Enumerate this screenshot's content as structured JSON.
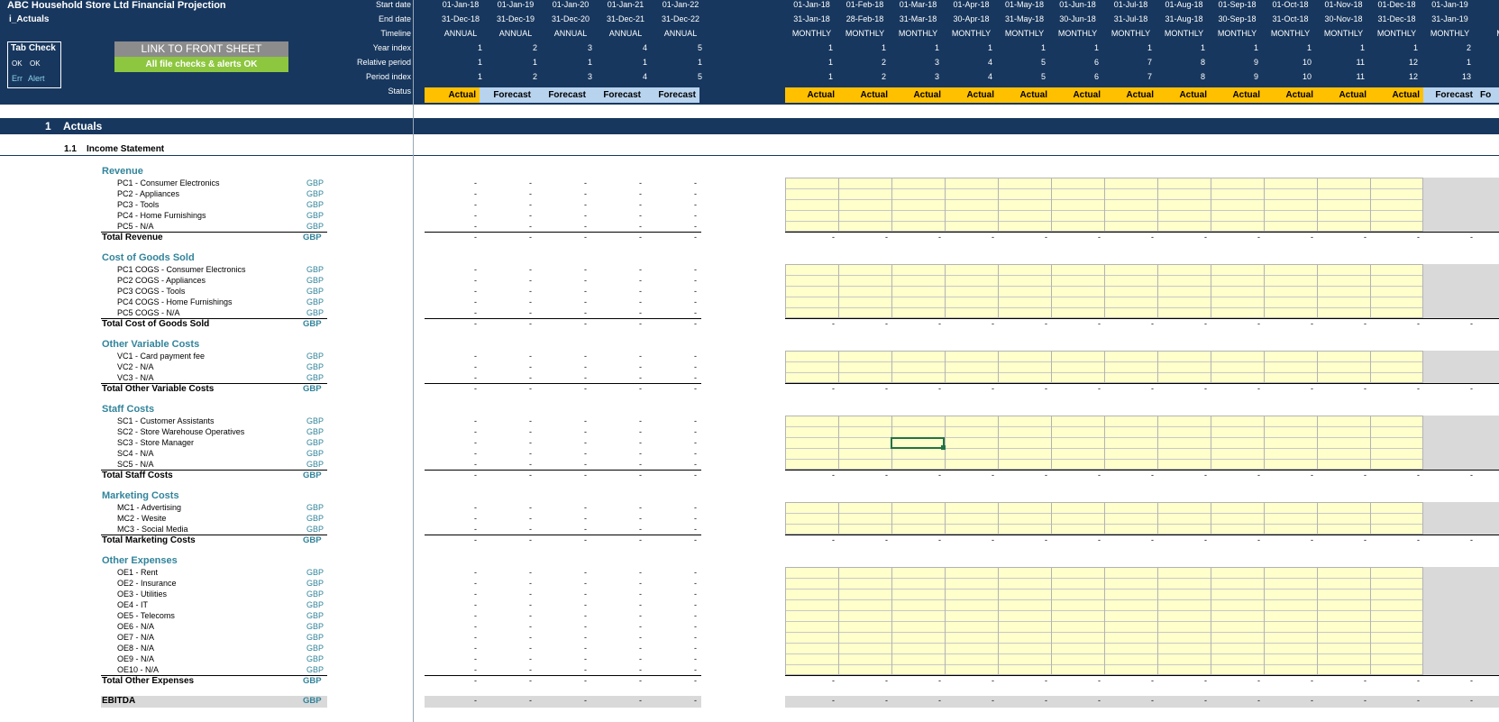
{
  "header": {
    "company_title": "ABC Household Store Ltd Financial Projection",
    "sheet_name": "i_Actuals",
    "row_labels": [
      "Start date",
      "End date",
      "Timeline",
      "Year index",
      "Relative period",
      "Period index",
      "Status"
    ],
    "annual_columns": [
      {
        "start": "01-Jan-18",
        "end": "31-Dec-18",
        "timeline": "ANNUAL",
        "year_index": "1",
        "relative_period": "1",
        "period_index": "1",
        "status": "Actual"
      },
      {
        "start": "01-Jan-19",
        "end": "31-Dec-19",
        "timeline": "ANNUAL",
        "year_index": "2",
        "relative_period": "1",
        "period_index": "2",
        "status": "Forecast"
      },
      {
        "start": "01-Jan-20",
        "end": "31-Dec-20",
        "timeline": "ANNUAL",
        "year_index": "3",
        "relative_period": "1",
        "period_index": "3",
        "status": "Forecast"
      },
      {
        "start": "01-Jan-21",
        "end": "31-Dec-21",
        "timeline": "ANNUAL",
        "year_index": "4",
        "relative_period": "1",
        "period_index": "4",
        "status": "Forecast"
      },
      {
        "start": "01-Jan-22",
        "end": "31-Dec-22",
        "timeline": "ANNUAL",
        "year_index": "5",
        "relative_period": "1",
        "period_index": "5",
        "status": "Forecast"
      }
    ],
    "monthly_columns": [
      {
        "start": "01-Jan-18",
        "end": "31-Jan-18",
        "timeline": "MONTHLY",
        "year_index": "1",
        "relative_period": "1",
        "period_index": "1",
        "status": "Actual"
      },
      {
        "start": "01-Feb-18",
        "end": "28-Feb-18",
        "timeline": "MONTHLY",
        "year_index": "1",
        "relative_period": "2",
        "period_index": "2",
        "status": "Actual"
      },
      {
        "start": "01-Mar-18",
        "end": "31-Mar-18",
        "timeline": "MONTHLY",
        "year_index": "1",
        "relative_period": "3",
        "period_index": "3",
        "status": "Actual"
      },
      {
        "start": "01-Apr-18",
        "end": "30-Apr-18",
        "timeline": "MONTHLY",
        "year_index": "1",
        "relative_period": "4",
        "period_index": "4",
        "status": "Actual"
      },
      {
        "start": "01-May-18",
        "end": "31-May-18",
        "timeline": "MONTHLY",
        "year_index": "1",
        "relative_period": "5",
        "period_index": "5",
        "status": "Actual"
      },
      {
        "start": "01-Jun-18",
        "end": "30-Jun-18",
        "timeline": "MONTHLY",
        "year_index": "1",
        "relative_period": "6",
        "period_index": "6",
        "status": "Actual"
      },
      {
        "start": "01-Jul-18",
        "end": "31-Jul-18",
        "timeline": "MONTHLY",
        "year_index": "1",
        "relative_period": "7",
        "period_index": "7",
        "status": "Actual"
      },
      {
        "start": "01-Aug-18",
        "end": "31-Aug-18",
        "timeline": "MONTHLY",
        "year_index": "1",
        "relative_period": "8",
        "period_index": "8",
        "status": "Actual"
      },
      {
        "start": "01-Sep-18",
        "end": "30-Sep-18",
        "timeline": "MONTHLY",
        "year_index": "1",
        "relative_period": "9",
        "period_index": "9",
        "status": "Actual"
      },
      {
        "start": "01-Oct-18",
        "end": "31-Oct-18",
        "timeline": "MONTHLY",
        "year_index": "1",
        "relative_period": "10",
        "period_index": "10",
        "status": "Actual"
      },
      {
        "start": "01-Nov-18",
        "end": "30-Nov-18",
        "timeline": "MONTHLY",
        "year_index": "1",
        "relative_period": "11",
        "period_index": "11",
        "status": "Actual"
      },
      {
        "start": "01-Dec-18",
        "end": "31-Dec-18",
        "timeline": "MONTHLY",
        "year_index": "1",
        "relative_period": "12",
        "period_index": "12",
        "status": "Actual"
      },
      {
        "start": "01-Jan-19",
        "end": "31-Jan-19",
        "timeline": "MONTHLY",
        "year_index": "2",
        "relative_period": "1",
        "period_index": "13",
        "status": "Forecast"
      },
      {
        "start": "",
        "end": "",
        "timeline": "MO",
        "year_index": "",
        "relative_period": "",
        "period_index": "",
        "status": "Fo"
      }
    ]
  },
  "tab_check": {
    "title": "Tab Check",
    "ok_1": "OK",
    "ok_2": "OK",
    "err": "Err",
    "alert": "Alert"
  },
  "buttons": {
    "link_front_sheet": "LINK TO FRONT SHEET",
    "checks_banner": "All file checks & alerts OK"
  },
  "section": {
    "number": "1",
    "title": "Actuals",
    "sub_number": "1.1",
    "sub_title": "Income Statement"
  },
  "unit": "GBP",
  "zero_value": "-",
  "groups": [
    {
      "title": "Revenue",
      "items": [
        "PC1 - Consumer Electronics",
        "PC2 - Appliances",
        "PC3 - Tools",
        "PC4 - Home Furnishings",
        "PC5 - N/A"
      ],
      "total": "Total Revenue"
    },
    {
      "title": "Cost of Goods Sold",
      "items": [
        "PC1 COGS - Consumer Electronics",
        "PC2 COGS - Appliances",
        "PC3 COGS - Tools",
        "PC4 COGS - Home Furnishings",
        "PC5 COGS - N/A"
      ],
      "total": "Total Cost of Goods Sold"
    },
    {
      "title": "Other Variable Costs",
      "items": [
        "VC1 - Card payment fee",
        "VC2 - N/A",
        "VC3 - N/A"
      ],
      "total": "Total Other Variable Costs"
    },
    {
      "title": "Staff Costs",
      "items": [
        "SC1 - Customer Assistants",
        "SC2 - Store Warehouse Operatives",
        "SC3 - Store Manager",
        "SC4 - N/A",
        "SC5 - N/A"
      ],
      "total": "Total Staff Costs"
    },
    {
      "title": "Marketing Costs",
      "items": [
        "MC1 - Advertising",
        "MC2 - Wesite",
        "MC3 - Social Media"
      ],
      "total": "Total Marketing Costs"
    },
    {
      "title": "Other Expenses",
      "items": [
        "OE1 - Rent",
        "OE2 - Insurance",
        "OE3 - Utilities",
        "OE4 - IT",
        "OE5 - Telecoms",
        "OE6 - N/A",
        "OE7 - N/A",
        "OE8 - N/A",
        "OE9 - N/A",
        "OE10 - N/A"
      ],
      "total": "Total Other Expenses"
    }
  ],
  "ebitda": {
    "label": "EBITDA"
  },
  "colors": {
    "header_bg": "#17375e",
    "actual": "#ffc000",
    "forecast": "#b8d3ee",
    "input_cell": "#ffffcc",
    "group_title": "#31849b"
  }
}
